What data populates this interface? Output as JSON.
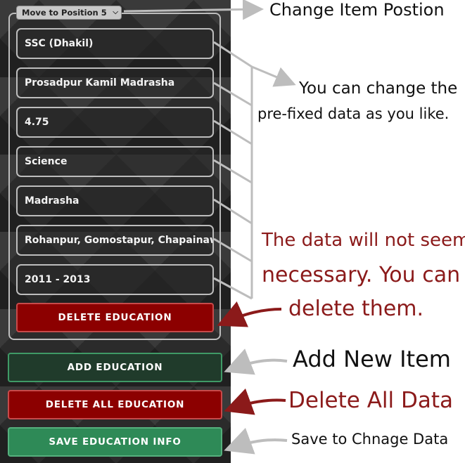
{
  "position_select": {
    "label": "Move to Position 5"
  },
  "fields": [
    {
      "value": "SSC (Dhakil)"
    },
    {
      "value": "Prosadpur Kamil Madrasha"
    },
    {
      "value": "4.75"
    },
    {
      "value": "Science"
    },
    {
      "value": "Madrasha"
    },
    {
      "value": "Rohanpur, Gomostapur, Chapainawa"
    },
    {
      "value": "2011 - 2013"
    }
  ],
  "buttons": {
    "delete_education": "DELETE EDUCATION",
    "add_education": "ADD EDUCATION",
    "delete_all_education": "DELETE ALL EDUCATION",
    "save_education_info": "SAVE EDUCATION INFO"
  },
  "annotations": {
    "change_position": "Change Item Postion",
    "change_data_line1": "You can change the",
    "change_data_line2": "pre-fixed data as you like.",
    "not_necessary_line1": "The data will not seem",
    "not_necessary_line2": "necessary. You can",
    "not_necessary_line3": "delete them.",
    "add_new": "Add New Item",
    "delete_all": "Delete All Data",
    "save": "Save to Chnage Data"
  },
  "colors": {
    "delete_red": "#8c0000",
    "add_dark_green": "#203b2b",
    "save_green": "#2e8a57",
    "annotation_red": "#8b1a1a",
    "annotation_black": "#111111",
    "arrow_gray": "#bdbdbd"
  }
}
